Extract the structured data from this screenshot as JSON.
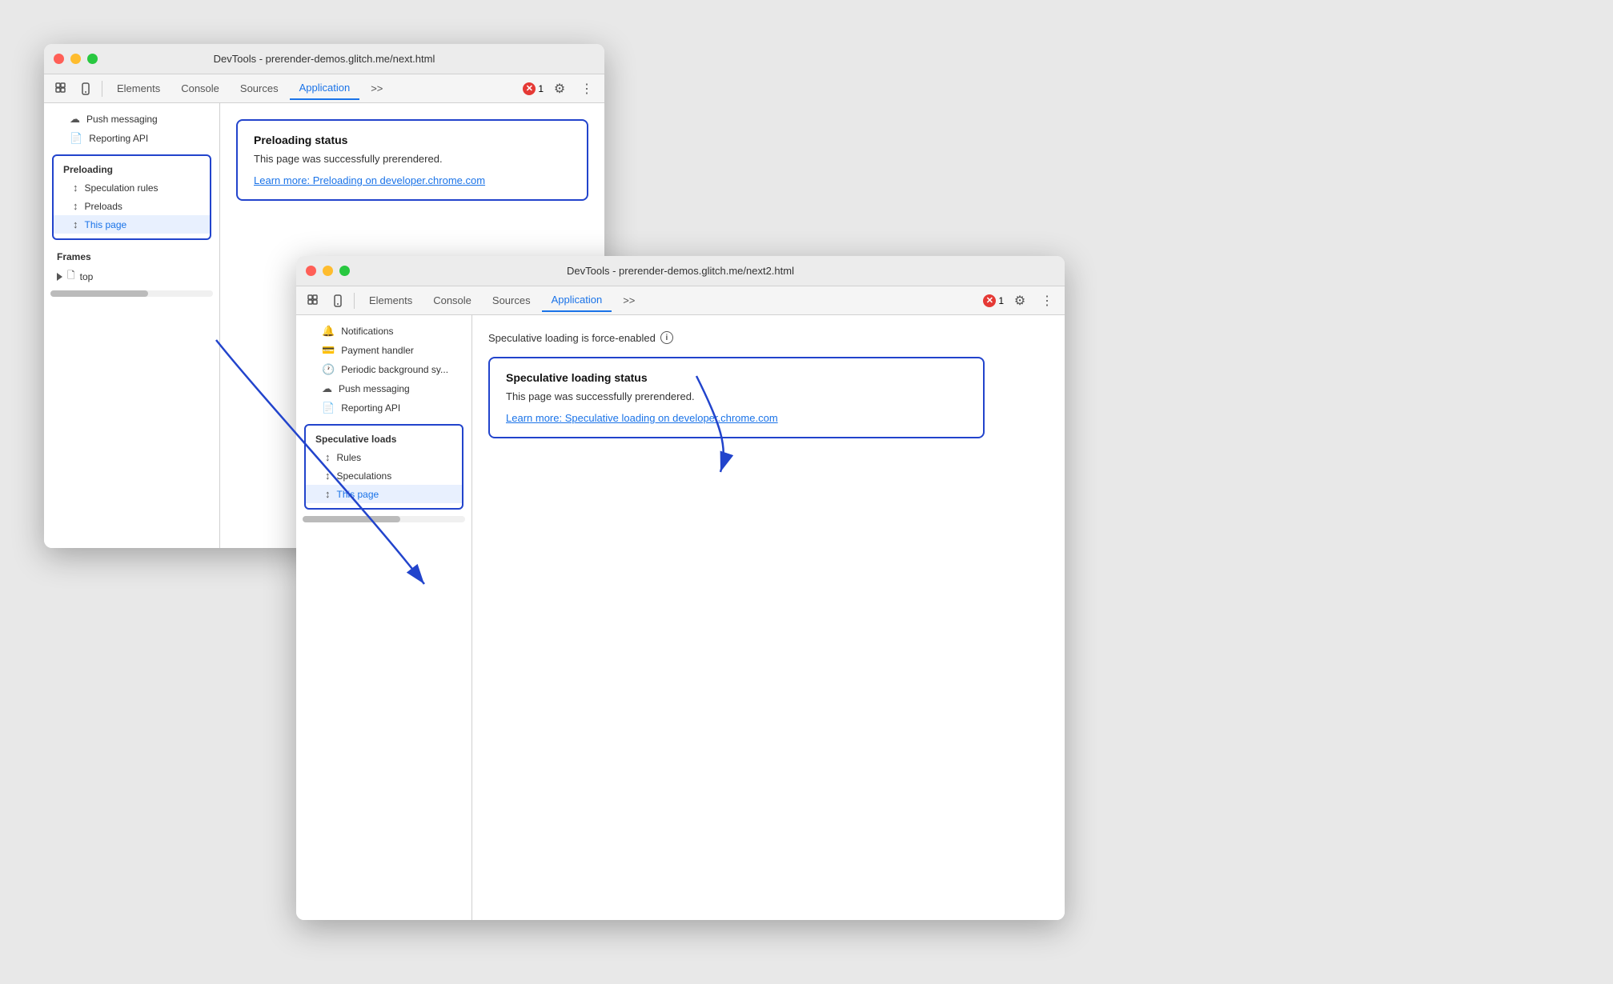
{
  "window1": {
    "title": "DevTools - prerender-demos.glitch.me/next.html",
    "tabs": [
      "Elements",
      "Console",
      "Sources",
      "Application"
    ],
    "activeTab": "Application",
    "sidebar": {
      "preloadingSection": {
        "label": "Preloading",
        "items": [
          {
            "label": "Speculation rules",
            "icon": "↕"
          },
          {
            "label": "Preloads",
            "icon": "↕"
          },
          {
            "label": "This page",
            "icon": "↕",
            "active": true
          }
        ]
      },
      "framesSection": {
        "label": "Frames",
        "items": [
          {
            "label": "top"
          }
        ]
      },
      "pushmessaging": {
        "label": "Push messaging"
      },
      "reportingapi": {
        "label": "Reporting API"
      }
    },
    "main": {
      "card": {
        "title": "Preloading status",
        "text": "This page was successfully prerendered.",
        "link": "Learn more: Preloading on developer.chrome.com"
      }
    },
    "errorCount": "1",
    "moreTabsLabel": ">>",
    "settingsLabel": "⚙",
    "moreLabel": "⋮"
  },
  "window2": {
    "title": "DevTools - prerender-demos.glitch.me/next2.html",
    "tabs": [
      "Elements",
      "Console",
      "Sources",
      "Application"
    ],
    "activeTab": "Application",
    "sidebar": {
      "items": [
        {
          "label": "Notifications",
          "icon": "🔔"
        },
        {
          "label": "Payment handler",
          "icon": "💳"
        },
        {
          "label": "Periodic background sy...",
          "icon": "🕐"
        },
        {
          "label": "Push messaging",
          "icon": "☁"
        },
        {
          "label": "Reporting API",
          "icon": "📄"
        }
      ],
      "speculativeLoadsSection": {
        "label": "Speculative loads",
        "items": [
          {
            "label": "Rules",
            "icon": "↕"
          },
          {
            "label": "Speculations",
            "icon": "↕"
          },
          {
            "label": "This page",
            "icon": "↕",
            "active": true
          }
        ]
      }
    },
    "main": {
      "forceEnabled": "Speculative loading is force-enabled",
      "card": {
        "title": "Speculative loading status",
        "text": "This page was successfully prerendered.",
        "link": "Learn more: Speculative loading on developer.chrome.com"
      }
    },
    "errorCount": "1",
    "moreTabsLabel": ">>",
    "settingsLabel": "⚙",
    "moreLabel": "⋮"
  },
  "icons": {
    "cursor": "⌗",
    "device": "📱",
    "settings": "⚙",
    "more": "⋮",
    "more_tabs": "»",
    "cloud": "☁",
    "file": "📄",
    "payment": "💳",
    "clock": "🕐",
    "bell": "🔔",
    "arrow_up_down": "↕"
  }
}
